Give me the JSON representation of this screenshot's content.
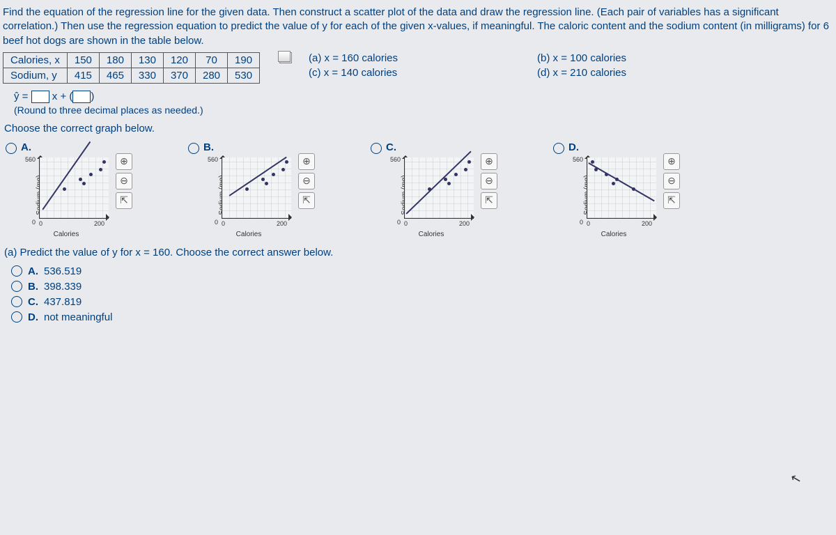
{
  "prompt": "Find the equation of the regression line for the given data. Then construct a scatter plot of the data and draw the regression line. (Each pair of variables has a significant correlation.) Then use the regression equation to predict the value of y for each of the given x-values, if meaningful. The caloric content and the sodium content (in milligrams) for 6 beef hot dogs are shown in the table below.",
  "table": {
    "row1_label": "Calories, x",
    "row2_label": "Sodium, y",
    "row1": [
      "150",
      "180",
      "130",
      "120",
      "70",
      "190"
    ],
    "row2": [
      "415",
      "465",
      "330",
      "370",
      "280",
      "530"
    ]
  },
  "xvals": {
    "a": "(a) x = 160 calories",
    "b": "(b) x = 100 calories",
    "c": "(c) x = 140 calories",
    "d": "(d) x = 210 calories"
  },
  "equation_prefix": "ŷ =",
  "equation_mid": "x + (",
  "equation_suffix": ")",
  "round_note": "(Round to three decimal places as needed.)",
  "choose_graph": "Choose the correct graph below.",
  "graph_labels": {
    "a": "A.",
    "b": "B.",
    "c": "C.",
    "d": "D."
  },
  "axis": {
    "y": "Sodium (mg)",
    "x": "Calories",
    "ymax": "560",
    "xmax": "200",
    "zero": "0"
  },
  "tools": {
    "zoom_in": "⊕",
    "zoom_out": "⊖",
    "popout": "⇱"
  },
  "predict_q": "(a) Predict the value of y for x = 160. Choose the correct answer below.",
  "answers": {
    "a_label": "A.",
    "a_val": "536.519",
    "b_label": "B.",
    "b_val": "398.339",
    "c_label": "C.",
    "c_val": "437.819",
    "d_label": "D.",
    "d_val": "not meaningful"
  },
  "chart_data": {
    "type": "scatter",
    "x": [
      150,
      180,
      130,
      120,
      70,
      190
    ],
    "y": [
      415,
      465,
      330,
      370,
      280,
      530
    ],
    "xlabel": "Calories",
    "ylabel": "Sodium (mg)",
    "xlim": [
      0,
      200
    ],
    "ylim": [
      0,
      560
    ],
    "title": ""
  }
}
